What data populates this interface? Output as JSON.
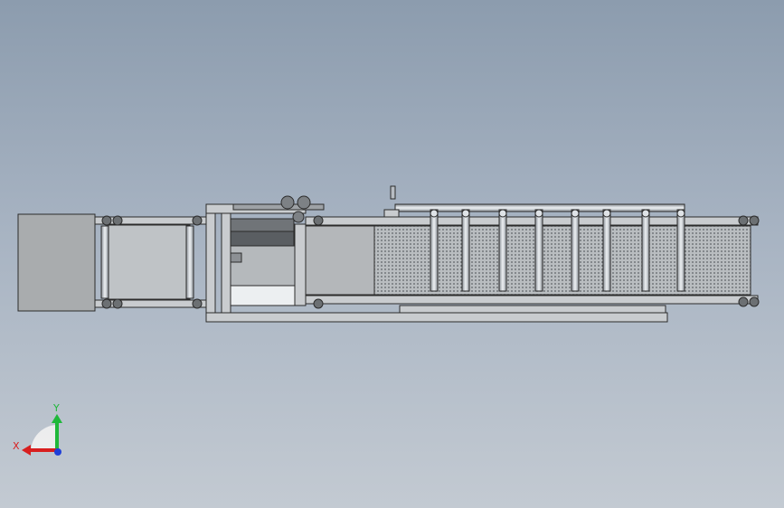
{
  "viewport": {
    "background_top": "#8c9cae",
    "background_bottom": "#c3cad2"
  },
  "model": {
    "frame_color": "#c9cccf",
    "edge_color": "#2b2b2b",
    "mesh_color": "#9aa0a4",
    "box_color": "#a9acae",
    "tube_color": "#b7bcc2",
    "highlight_color": "#f1f3f5"
  },
  "triad": {
    "x_label": "X",
    "y_label": "Y",
    "x_color": "#d81f1f",
    "y_color": "#1fb83a",
    "z_color": "#1f3fd8"
  }
}
